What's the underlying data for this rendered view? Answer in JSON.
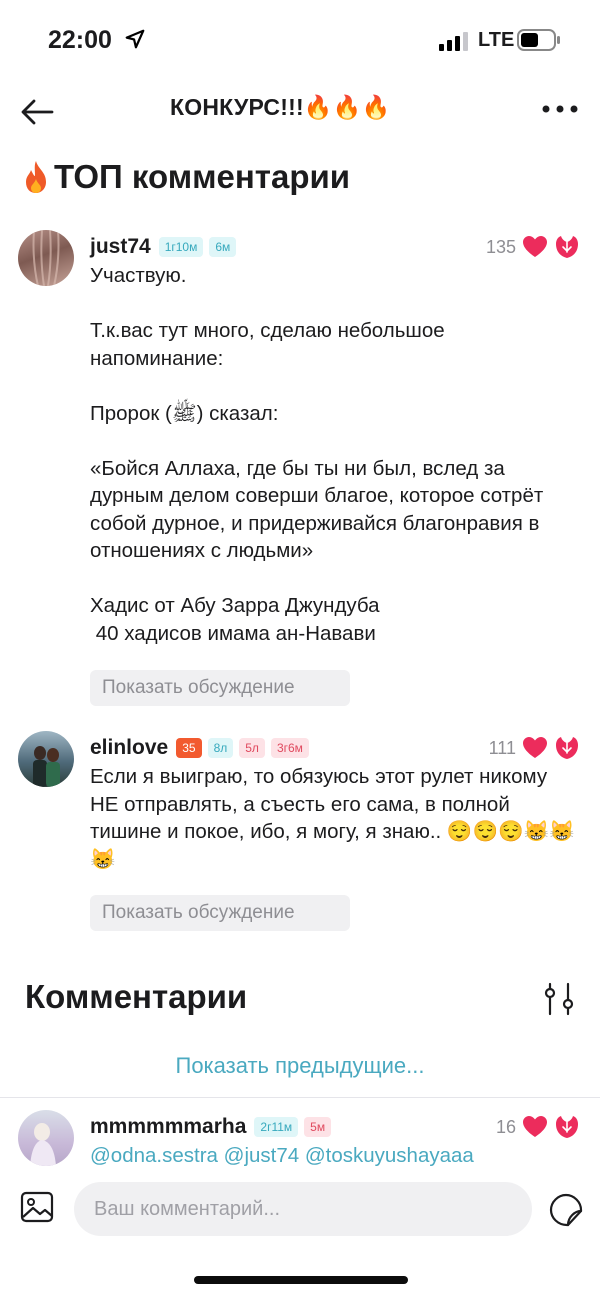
{
  "status_bar": {
    "time": "22:00",
    "network": "LTE"
  },
  "nav": {
    "title": "КОНКУРС!!!🔥🔥🔥"
  },
  "top_section": {
    "title": "ТОП комментарии"
  },
  "top_comments": [
    {
      "username": "just74",
      "badges": [
        "1г10м",
        "6м"
      ],
      "likes": "135",
      "text": "Участвую.\n\nТ.к.вас тут много, сделаю небольшое напоминание:\n\nПророк (ﷺ) сказал:\n\n«Бойся Аллаха, где бы ты ни был, вслед за дурным делом соверши благое, которое сотрёт собой дурное, и придерживайся благонравия в отношениях с людьми»\n\nХадис от Абу Зарра Джундуба\n 40 хадисов имама ан-Навави",
      "show_discussion": "Показать обсуждение"
    },
    {
      "username": "elinlove",
      "badges": [
        "35",
        "8л",
        "5л",
        "3г6м"
      ],
      "likes": "111",
      "text": "Если я выиграю, то обязуюсь этот рулет никому НЕ отправлять, а съесть его сама, в полной тишине и покое, ибо, я могу, я знаю.. 😌😌😌😸😸😸",
      "show_discussion": "Показать обсуждение"
    }
  ],
  "comments_section": {
    "title": "Комментарии",
    "show_previous": "Показать предыдущие..."
  },
  "comments": [
    {
      "username": "mmmmmmarha",
      "badges": [
        "2г11м",
        "5м"
      ],
      "likes": "16",
      "text": "@odna.sestra @just74 @toskuyushayaaa"
    }
  ],
  "input": {
    "placeholder": "Ваш комментарий..."
  },
  "colors": {
    "accent": "#4aa9c0",
    "heart": "#ec2c5c",
    "badge_orange": "#f25a2f"
  },
  "icons": [
    "location-arrow-icon",
    "signal-icon",
    "battery-icon",
    "back-arrow-icon",
    "more-icon",
    "fire-icon",
    "heart-icon",
    "tulip-icon",
    "filter-icon",
    "image-icon",
    "sticker-icon"
  ]
}
